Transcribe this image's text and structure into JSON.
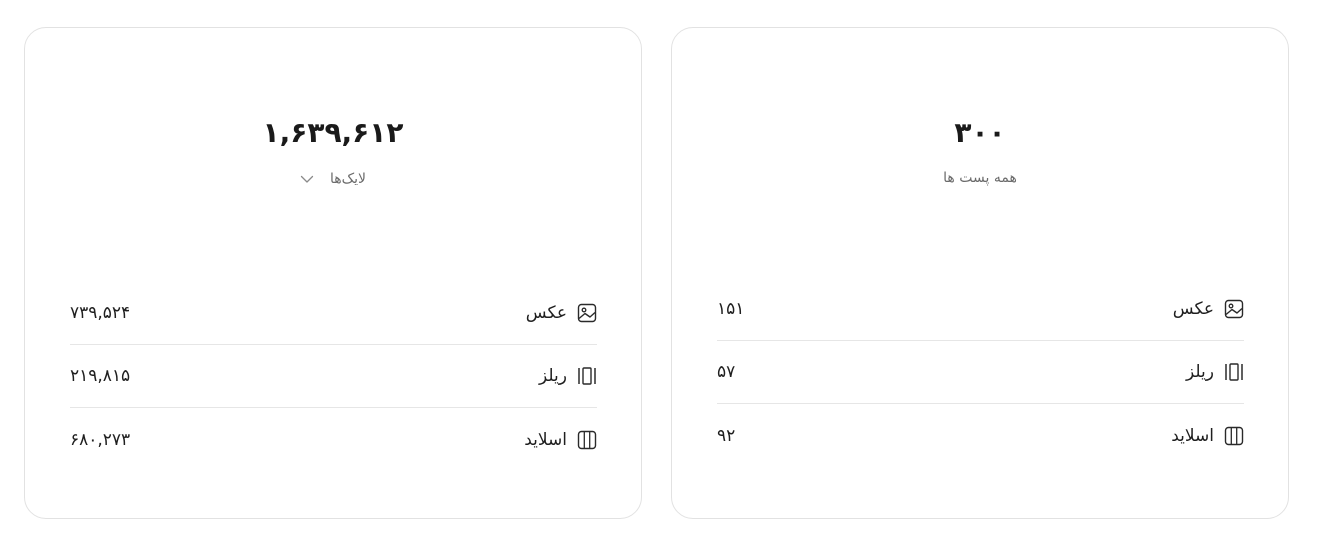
{
  "likes_card": {
    "total": "۱,۶۳۹,۶۱۲",
    "metric_label": "لایک‌ها",
    "dropdown_icon": "chevron-down-icon",
    "rows": [
      {
        "label": "عکس",
        "value": "۷۳۹,۵۲۴",
        "icon": "image-icon"
      },
      {
        "label": "ریلز",
        "value": "۲۱۹,۸۱۵",
        "icon": "reels-icon"
      },
      {
        "label": "اسلاید",
        "value": "۶۸۰,۲۷۳",
        "icon": "slides-icon"
      }
    ]
  },
  "posts_card": {
    "total": "۳۰۰",
    "label": "همه پست ها",
    "rows": [
      {
        "label": "عکس",
        "value": "۱۵۱",
        "icon": "image-icon"
      },
      {
        "label": "ریلز",
        "value": "۵۷",
        "icon": "reels-icon"
      },
      {
        "label": "اسلاید",
        "value": "۹۲",
        "icon": "slides-icon"
      }
    ]
  }
}
